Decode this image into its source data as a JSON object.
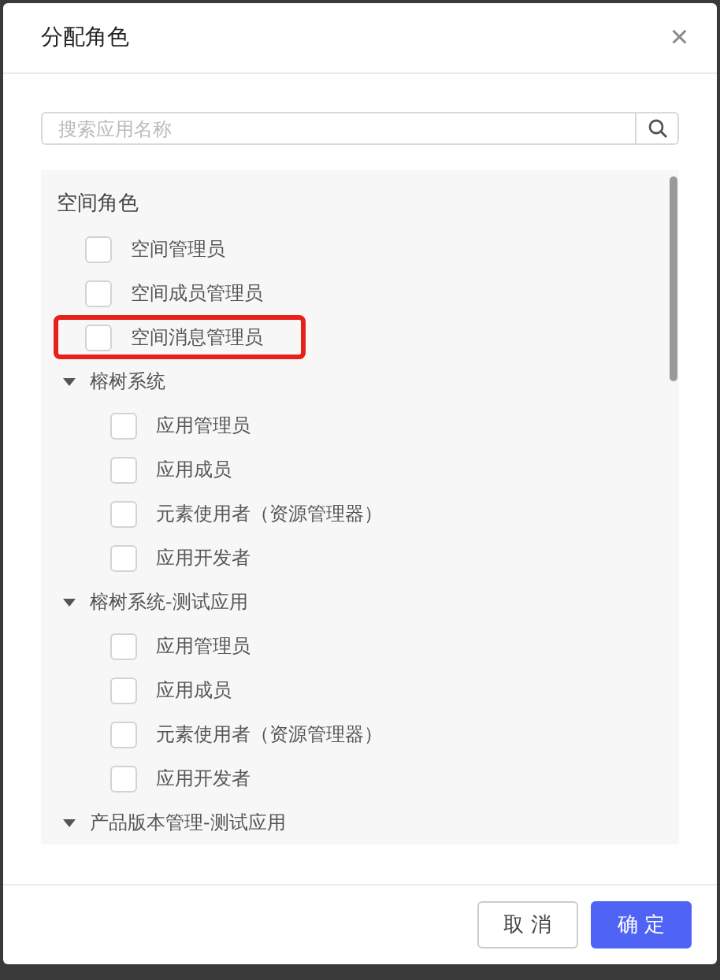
{
  "dialog": {
    "title": "分配角色",
    "close": "×"
  },
  "search": {
    "placeholder": "搜索应用名称"
  },
  "space_roles": {
    "title": "空间角色",
    "items": [
      {
        "label": "空间管理员",
        "checked": false,
        "highlighted": false
      },
      {
        "label": "空间成员管理员",
        "checked": false,
        "highlighted": false
      },
      {
        "label": "空间消息管理员",
        "checked": false,
        "highlighted": true
      }
    ]
  },
  "app_groups": [
    {
      "name": "榕树系统",
      "expanded": true,
      "roles": [
        {
          "label": "应用管理员",
          "checked": false
        },
        {
          "label": "应用成员",
          "checked": false
        },
        {
          "label": "元素使用者（资源管理器）",
          "checked": false
        },
        {
          "label": "应用开发者",
          "checked": false
        }
      ]
    },
    {
      "name": "榕树系统-测试应用",
      "expanded": true,
      "roles": [
        {
          "label": "应用管理员",
          "checked": false
        },
        {
          "label": "应用成员",
          "checked": false
        },
        {
          "label": "元素使用者（资源管理器）",
          "checked": false
        },
        {
          "label": "应用开发者",
          "checked": false
        }
      ]
    },
    {
      "name": "产品版本管理-测试应用",
      "expanded": true
    }
  ],
  "buttons": [
    {
      "label": "取 消",
      "kind": "secondary"
    },
    {
      "label": "确 定",
      "kind": "primary"
    }
  ]
}
